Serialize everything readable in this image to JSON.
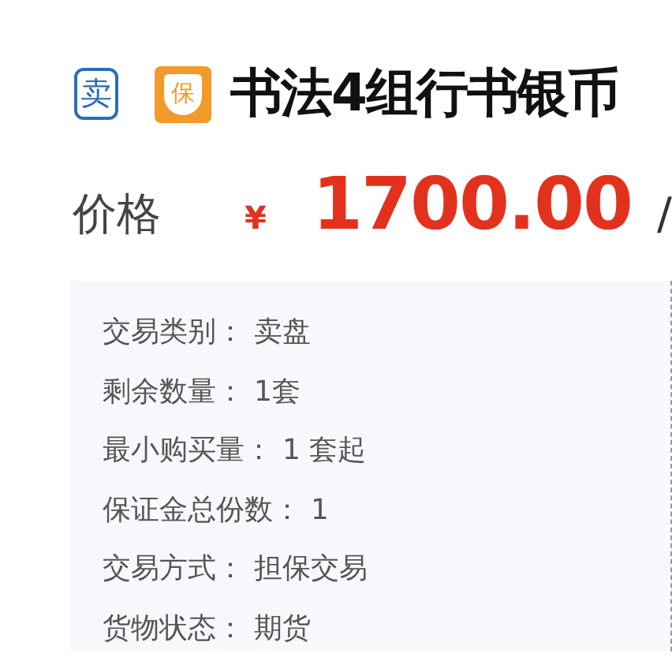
{
  "badges": [
    {
      "kind": "sell",
      "text": "卖"
    },
    {
      "kind": "guarantee",
      "text": "保"
    }
  ],
  "title": "书法4组行书银币",
  "price": {
    "label": "价格",
    "currency": "¥",
    "amount": "1700.00",
    "separator": "/"
  },
  "details": [
    {
      "label": "交易类别：",
      "value": "卖盘"
    },
    {
      "label": "剩余数量：",
      "value": "1套"
    },
    {
      "label": "最小购买量：",
      "value": "1 套起"
    },
    {
      "label": "保证金总份数：",
      "value": "1"
    },
    {
      "label": "交易方式：",
      "value": "担保交易"
    },
    {
      "label": "货物状态：",
      "value": "期货"
    }
  ]
}
